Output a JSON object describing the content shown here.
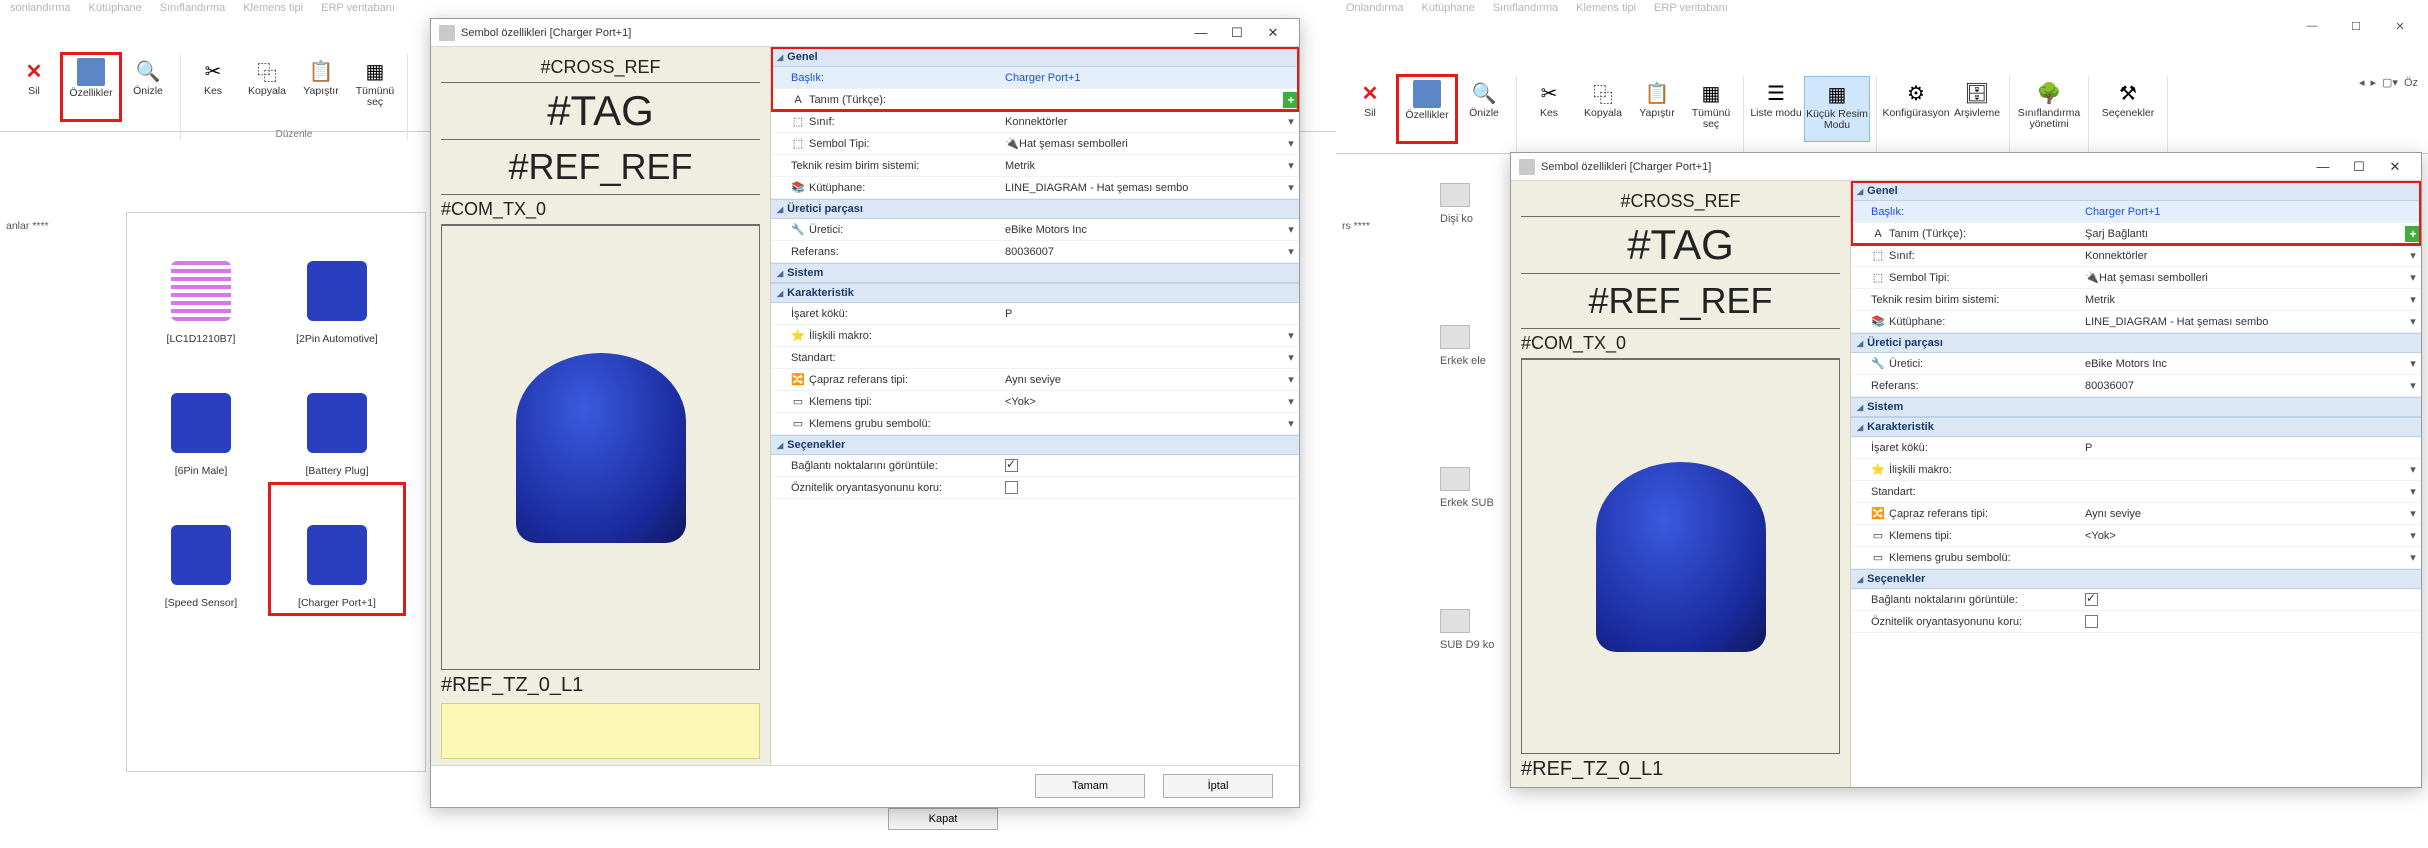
{
  "faded_tabs": [
    "sonlandırma",
    "Kütüphane",
    "Sınıflandırma",
    "Klemens tipi",
    "ERP veritabanı"
  ],
  "faded_tabs_r": [
    "Onlandırma",
    "Kütüphane",
    "Sınıflandırma",
    "Klemens tipi",
    "ERP veritabanı"
  ],
  "ribbon_left": {
    "sil": "Sil",
    "ozellikler": "Özellikler",
    "onizle": "Önizle",
    "kes": "Kes",
    "kopyala": "Kopyala",
    "yapistir": "Yapıştır",
    "tumunu": "Tümünü seç",
    "grp_duzenle": "Düzenle"
  },
  "ribbon_right": {
    "sil": "Sil",
    "ozellikler": "Özellikler",
    "onizle": "Önizle",
    "kes": "Kes",
    "kopyala": "Kopyala",
    "yapistir": "Yapıştır",
    "tumunu": "Tümünü seç",
    "liste": "Liste modu",
    "kucuk": "Küçük Resim Modu",
    "konfig": "Konfigürasyon",
    "arsiv": "Arşivleme",
    "sinif": "Sınıflandırma yönetimi",
    "secenekler": "Seçenekler",
    "oz_extra": "Öz"
  },
  "tree_stub_left": "anlar ****",
  "thumbs": [
    {
      "cap": "[LC1D1210B7]",
      "kind": "mag"
    },
    {
      "cap": "[2Pin Automotive]",
      "kind": "blue"
    },
    {
      "cap": "[6Pin Male]",
      "kind": "blue"
    },
    {
      "cap": "[Battery Plug]",
      "kind": "blue"
    },
    {
      "cap": "[Speed Sensor]",
      "kind": "blue"
    },
    {
      "cap": "[Charger Port+1]",
      "kind": "blue",
      "sel": true
    }
  ],
  "dialog_left": {
    "title": "Sembol özellikleri [Charger Port+1]",
    "preview": {
      "crossref": "#CROSS_REF",
      "tag": "#TAG",
      "refref": "#REF_REF",
      "com": "#COM_TX_0",
      "reftz": "#REF_TZ_0_L1"
    },
    "groups": {
      "genel": "Genel",
      "rows_genel": [
        {
          "k": "Başlık:",
          "v": "Charger Port+1",
          "blueK": true,
          "blueV": true
        },
        {
          "k": "Tanım (Türkçe):",
          "v": "",
          "plus": true,
          "icon": "A"
        },
        {
          "k": "Sınıf:",
          "v": "Konnektörler",
          "dd": true,
          "icon": "⬚"
        },
        {
          "k": "Sembol Tipi:",
          "v": "Hat şeması sembolleri",
          "dd": true,
          "icon": "⬚",
          "vicon": "🔌"
        },
        {
          "k": "Teknik resim birim sistemi:",
          "v": "Metrik",
          "dd": true
        },
        {
          "k": "Kütüphane:",
          "v": "LINE_DIAGRAM - Hat şeması sembo",
          "dd": true,
          "icon": "📚"
        }
      ],
      "uretici": "Üretici parçası",
      "rows_uretici": [
        {
          "k": "Üretici:",
          "v": "eBike Motors Inc",
          "dd": true,
          "icon": "🔧"
        },
        {
          "k": "Referans:",
          "v": "80036007",
          "dd": true
        }
      ],
      "sistem": "Sistem",
      "karak": "Karakteristik",
      "rows_karak": [
        {
          "k": "İşaret kökü:",
          "v": "P"
        },
        {
          "k": "İlişkili makro:",
          "v": "",
          "dd": true,
          "icon": "⭐"
        },
        {
          "k": "Standart:",
          "v": "",
          "dd": true
        },
        {
          "k": "Çapraz referans tipi:",
          "v": "Aynı seviye",
          "dd": true,
          "icon": "🔀"
        },
        {
          "k": "Klemens tipi:",
          "v": "<Yok>",
          "dd": true,
          "icon": "▭"
        },
        {
          "k": "Klemens grubu sembolü:",
          "v": "",
          "dd": true,
          "icon": "▭"
        }
      ],
      "secen": "Seçenekler",
      "rows_secen": [
        {
          "k": "Bağlantı noktalarını görüntüle:",
          "chk": true,
          "on": true
        },
        {
          "k": "Öznitelik oryantasyonunu koru:",
          "chk": true,
          "on": false
        }
      ]
    },
    "foot": {
      "ok": "Tamam",
      "cancel": "İptal"
    }
  },
  "kapat": "Kapat",
  "tree_stub_right": "rs ****",
  "right_tree": [
    "Dişi ko",
    "Erkek ele",
    "Erkek SUB",
    "SUB D9 ko"
  ],
  "dialog_right": {
    "title": "Sembol özellikleri [Charger Port+1]",
    "preview": {
      "crossref": "#CROSS_REF",
      "tag": "#TAG",
      "refref": "#REF_REF",
      "com": "#COM_TX_0",
      "reftz": "#REF_TZ_0_L1"
    },
    "groups": {
      "genel": "Genel",
      "rows_genel": [
        {
          "k": "Başlık:",
          "v": "Charger Port+1",
          "blueK": true,
          "blueV": true
        },
        {
          "k": "Tanım (Türkçe):",
          "v": "Şarj Bağlantı",
          "plus": true,
          "icon": "A"
        },
        {
          "k": "Sınıf:",
          "v": "Konnektörler",
          "dd": true,
          "icon": "⬚"
        },
        {
          "k": "Sembol Tipi:",
          "v": "Hat şeması sembolleri",
          "dd": true,
          "icon": "⬚",
          "vicon": "🔌"
        },
        {
          "k": "Teknik resim birim sistemi:",
          "v": "Metrik",
          "dd": true
        },
        {
          "k": "Kütüphane:",
          "v": "LINE_DIAGRAM - Hat şeması sembo",
          "dd": true,
          "icon": "📚"
        }
      ],
      "uretici": "Üretici parçası",
      "rows_uretici": [
        {
          "k": "Üretici:",
          "v": "eBike Motors Inc",
          "dd": true,
          "icon": "🔧"
        },
        {
          "k": "Referans:",
          "v": "80036007",
          "dd": true
        }
      ],
      "sistem": "Sistem",
      "karak": "Karakteristik",
      "rows_karak": [
        {
          "k": "İşaret kökü:",
          "v": "P"
        },
        {
          "k": "İlişkili makro:",
          "v": "",
          "dd": true,
          "icon": "⭐"
        },
        {
          "k": "Standart:",
          "v": "",
          "dd": true
        },
        {
          "k": "Çapraz referans tipi:",
          "v": "Aynı seviye",
          "dd": true,
          "icon": "🔀"
        },
        {
          "k": "Klemens tipi:",
          "v": "<Yok>",
          "dd": true,
          "icon": "▭"
        },
        {
          "k": "Klemens grubu sembolü:",
          "v": "",
          "dd": true,
          "icon": "▭"
        }
      ],
      "secen": "Seçenekler",
      "rows_secen": [
        {
          "k": "Bağlantı noktalarını görüntüle:",
          "chk": true,
          "on": true
        },
        {
          "k": "Öznitelik oryantasyonunu koru:",
          "chk": true,
          "on": false
        }
      ]
    }
  }
}
